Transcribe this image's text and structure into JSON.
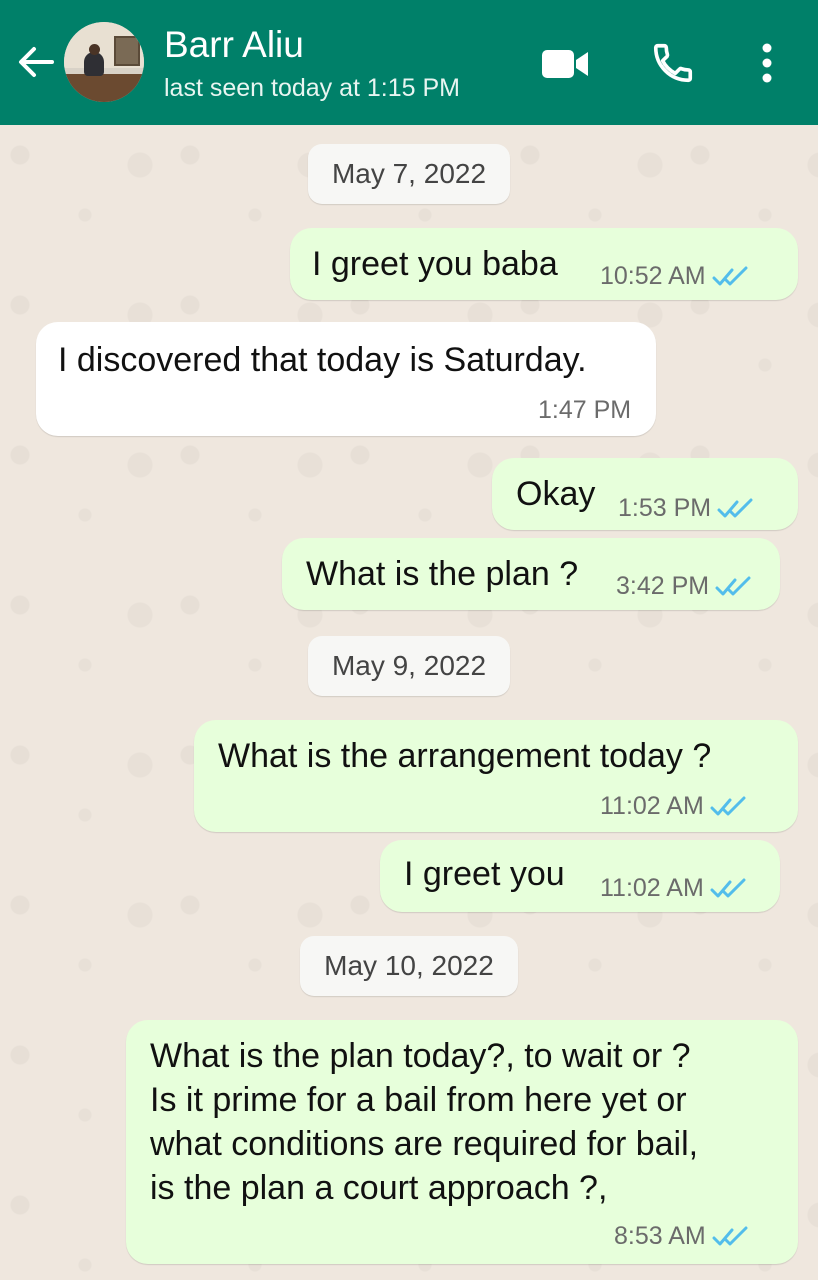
{
  "header": {
    "contact_name": "Barr Aliu",
    "last_seen": "last seen today at 1:15 PM",
    "accent_color": "#008069"
  },
  "icons": {
    "back": "arrow-left-icon",
    "video": "video-camera-icon",
    "call": "phone-icon",
    "menu": "more-vertical-icon",
    "read": "double-check-icon"
  },
  "messages": [
    {
      "type": "date",
      "text": "May 7, 2022"
    },
    {
      "type": "out",
      "text": "I greet you baba",
      "time": "10:52 AM",
      "status": "read"
    },
    {
      "type": "in",
      "text": "I discovered that today is Saturday.",
      "time": "1:47 PM"
    },
    {
      "type": "out",
      "text": "Okay",
      "time": "1:53 PM",
      "status": "read"
    },
    {
      "type": "out",
      "text": "What is the plan ?",
      "time": "3:42 PM",
      "status": "read"
    },
    {
      "type": "date",
      "text": "May 9, 2022"
    },
    {
      "type": "out",
      "text": "What is the arrangement today ?",
      "time": "11:02 AM",
      "status": "read"
    },
    {
      "type": "out",
      "text": "I greet you",
      "time": "11:02 AM",
      "status": "read"
    },
    {
      "type": "date",
      "text": "May 10, 2022"
    },
    {
      "type": "out",
      "text": "What is the plan today?, to wait or ?\nIs it prime for a bail from here yet  or\nwhat conditions are required for bail,\nis the plan a court approach ?,",
      "time": "8:53 AM",
      "status": "read"
    }
  ],
  "colors": {
    "outgoing_bubble": "#e7ffdb",
    "incoming_bubble": "#ffffff",
    "read_tick": "#53bdeb",
    "wallpaper": "#efe7de"
  }
}
